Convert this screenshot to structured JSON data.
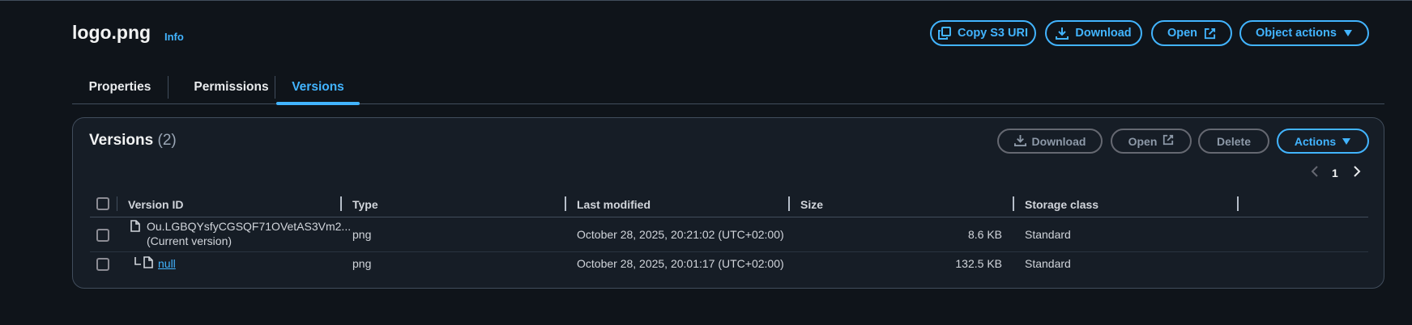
{
  "header": {
    "title": "logo.png",
    "info_label": "Info",
    "buttons": {
      "copy_s3_uri": "Copy S3 URI",
      "download": "Download",
      "open": "Open",
      "object_actions": "Object actions"
    }
  },
  "tabs": [
    {
      "label": "Properties",
      "active": false
    },
    {
      "label": "Permissions",
      "active": false
    },
    {
      "label": "Versions",
      "active": true
    }
  ],
  "versions_panel": {
    "title": "Versions",
    "count": "(2)",
    "buttons": {
      "download": "Download",
      "open": "Open",
      "delete": "Delete",
      "actions": "Actions"
    },
    "pagination": {
      "current_page": "1"
    },
    "columns": [
      "Version ID",
      "Type",
      "Last modified",
      "Size",
      "Storage class"
    ],
    "rows": [
      {
        "version_id": "Ou.LGBQYsfyCGSQF71OVetAS3Vm2...",
        "version_note": "(Current version)",
        "type": "png",
        "last_modified": "October 28, 2025, 20:21:02 (UTC+02:00)",
        "size": "8.6 KB",
        "storage_class": "Standard"
      },
      {
        "version_id": "null",
        "version_note": "",
        "type": "png",
        "last_modified": "October 28, 2025, 20:01:17 (UTC+02:00)",
        "size": "132.5 KB",
        "storage_class": "Standard"
      }
    ]
  },
  "colors": {
    "background": "#0f141a",
    "panel": "#161d26",
    "accent": "#42b4ff",
    "border": "#414d5c",
    "disabled": "#8d99a8"
  },
  "icons": [
    "copy-icon",
    "download-icon",
    "external-link-icon",
    "caret-down-icon",
    "chevron-left-icon",
    "chevron-right-icon",
    "file-icon",
    "tree-branch-icon"
  ]
}
